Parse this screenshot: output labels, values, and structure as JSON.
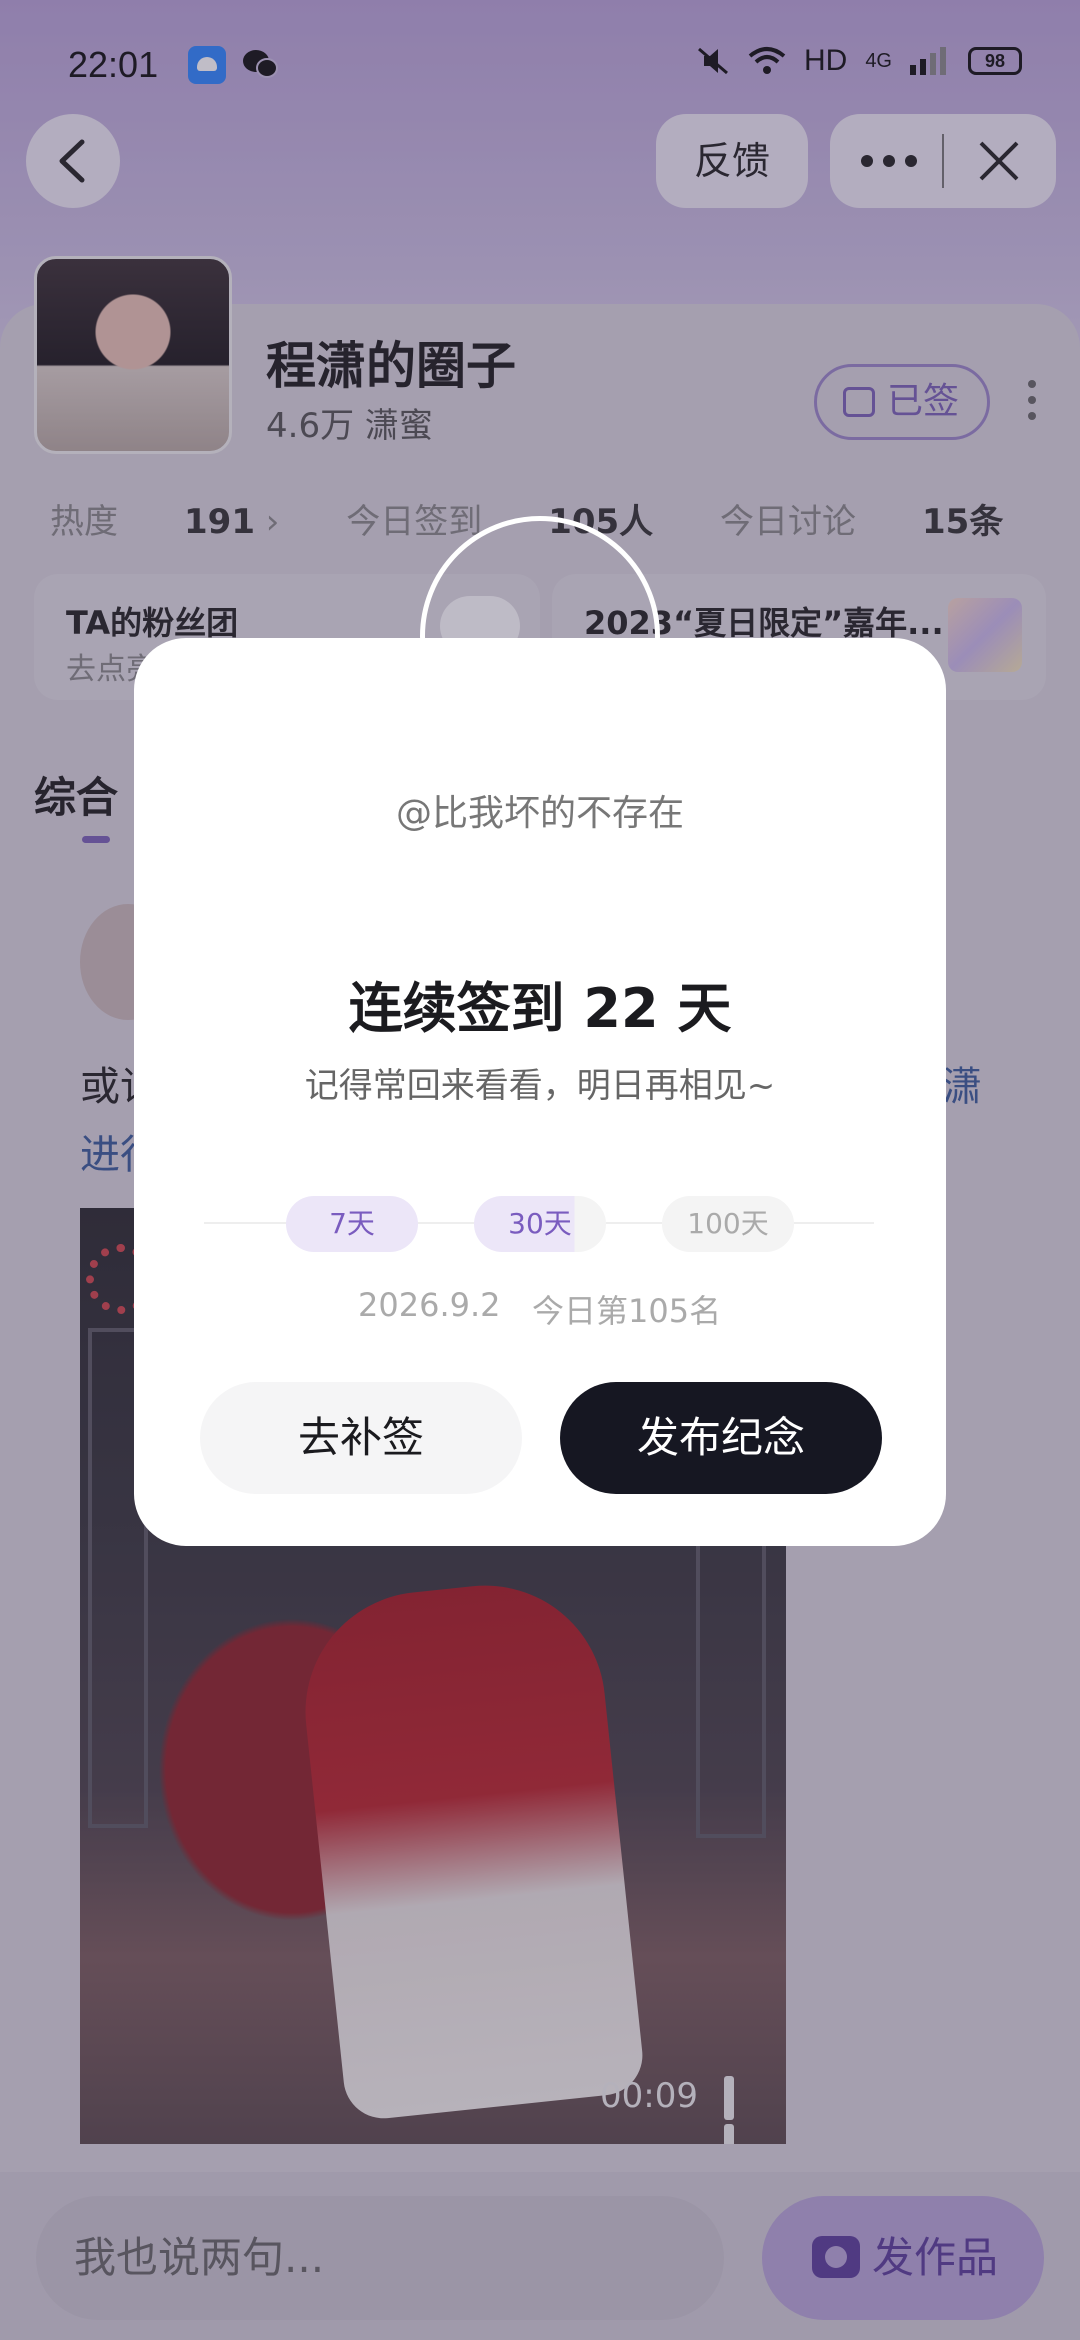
{
  "status_bar": {
    "time": "22:01",
    "network": "HD",
    "signal": "4G",
    "battery": "98",
    "icons": [
      "android-app-icon",
      "wechat-icon",
      "mute-icon",
      "wifi-icon",
      "signal-icon"
    ]
  },
  "top_bar": {
    "feedback_label": "反馈"
  },
  "circle": {
    "title": "程潇的圈子",
    "subtitle": "4.6万 潇蜜",
    "signed_label": "已签",
    "stats": {
      "heat_label": "热度",
      "heat_value": "191",
      "checkin_label": "今日签到",
      "checkin_value": "105人",
      "discuss_label": "今日讨论",
      "discuss_value": "15条"
    },
    "mini_cards": [
      {
        "title": "TA的粉丝团",
        "sub": "去点亮"
      },
      {
        "title": "2023“夏日限定”嘉年..."
      }
    ],
    "tab": "综合"
  },
  "post": {
    "text_line1": "或许",
    "text_line2": "进行",
    "link_suffix": "潇",
    "video_time": "00:09"
  },
  "bottom_bar": {
    "input_placeholder": "我也说两句...",
    "publish_label": "发作品"
  },
  "modal": {
    "user": "@比我坏的不存在",
    "title": "连续签到 22 天",
    "subtitle": "记得常回来看看，明日再相见~",
    "milestones": [
      "7天",
      "30天",
      "100天"
    ],
    "progress_to_30": 0.76,
    "date": "2026.9.2",
    "rank": "今日第105名",
    "makeup_label": "去补签",
    "publish_label": "发布纪念"
  },
  "colors": {
    "accent": "#7a5cbf",
    "dark_button": "#161722"
  }
}
